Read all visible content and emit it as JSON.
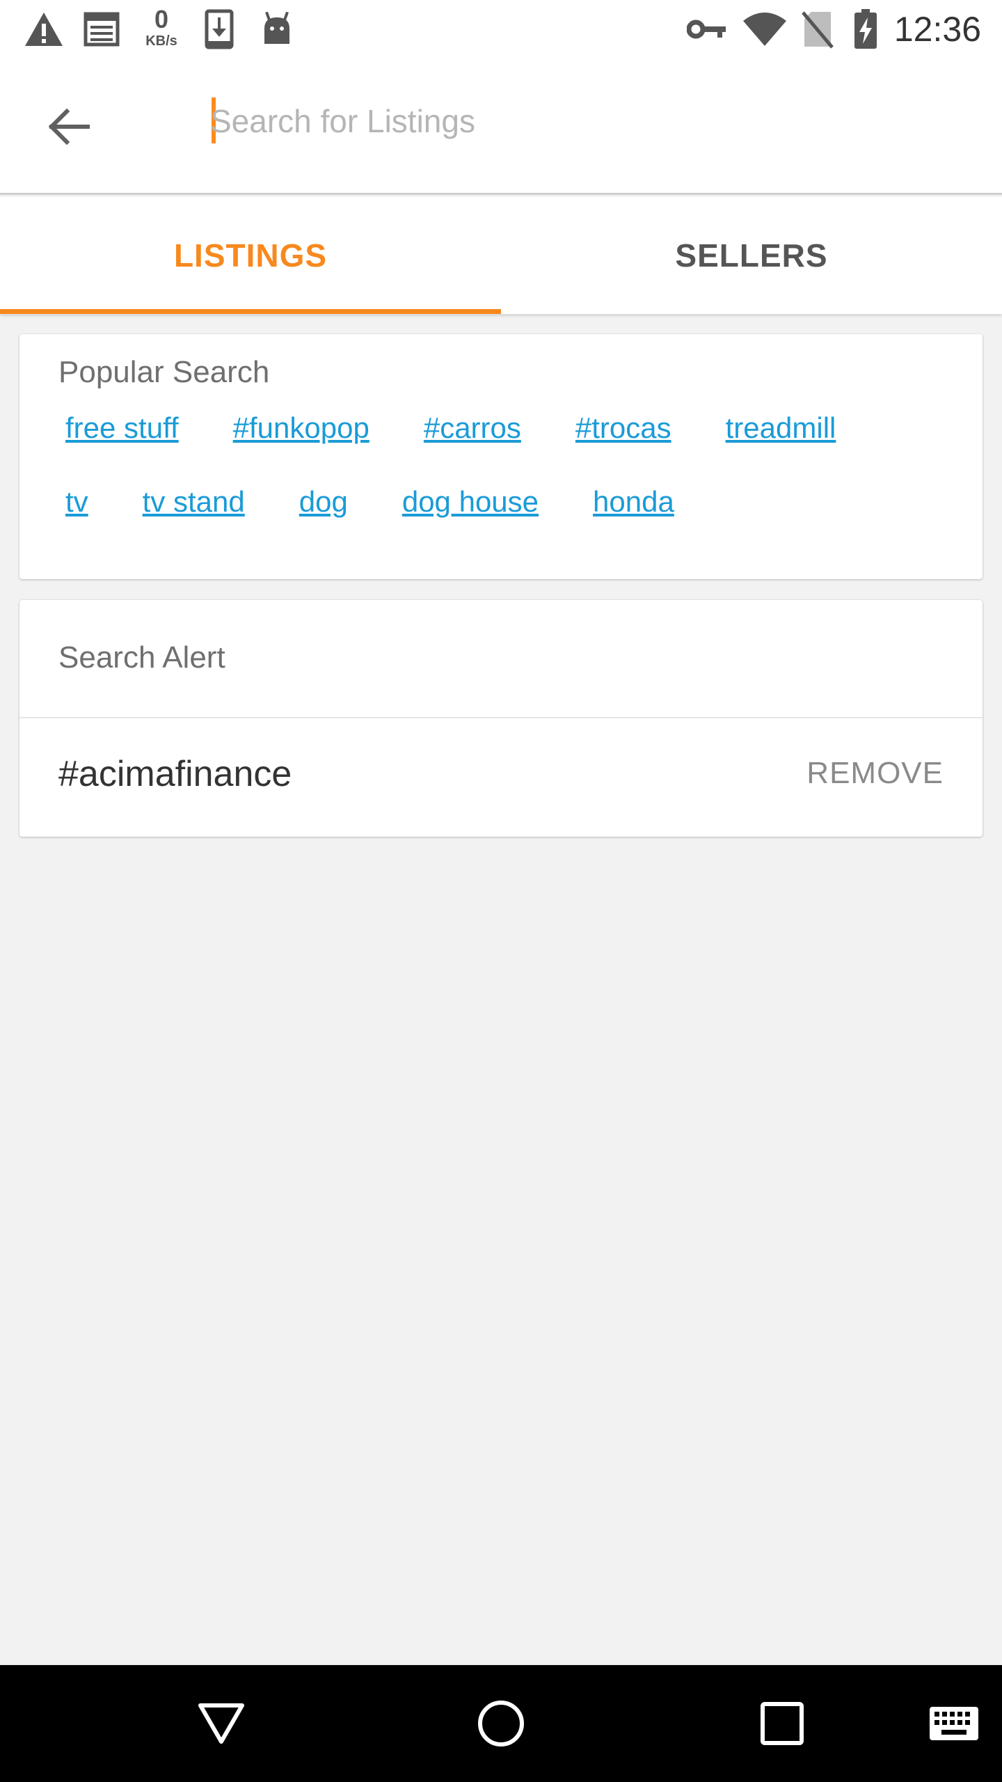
{
  "status_bar": {
    "time": "12:36",
    "data_rate_value": "0",
    "data_rate_unit": "KB/s",
    "icons": [
      "warning-icon",
      "news-icon",
      "download-icon",
      "android-icon",
      "vpn-key-icon",
      "wifi-icon",
      "no-sim-icon",
      "battery-charging-icon"
    ]
  },
  "app_bar": {
    "search_placeholder": "Search for Listings",
    "search_value": ""
  },
  "tabs": [
    {
      "label": "LISTINGS",
      "active": true
    },
    {
      "label": "SELLERS",
      "active": false
    }
  ],
  "popular_search": {
    "title": "Popular Search",
    "rows": [
      [
        "free stuff",
        "#funkopop",
        "#carros",
        "#trocas",
        "treadmill"
      ],
      [
        "tv",
        "tv stand",
        "dog",
        "dog house",
        "honda"
      ]
    ]
  },
  "search_alert": {
    "title": "Search Alert",
    "items": [
      {
        "term": "#acimafinance",
        "action": "REMOVE"
      }
    ]
  },
  "colors": {
    "accent": "#f7891e",
    "link": "#1a9bd7",
    "background": "#f2f2f2"
  }
}
